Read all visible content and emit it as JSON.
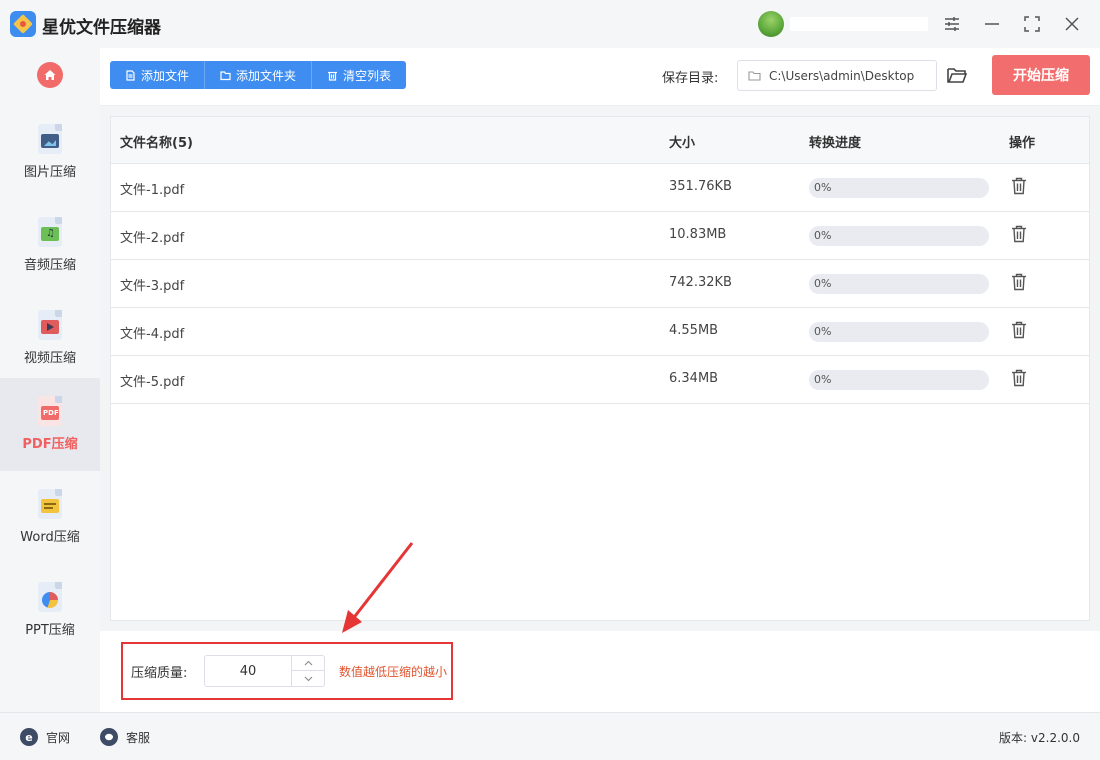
{
  "app": {
    "title": "星优文件压缩器"
  },
  "window_controls": [
    "settings-icon",
    "minimize-icon",
    "maximize-icon",
    "close-icon"
  ],
  "sidebar": {
    "items": [
      {
        "label": "图片压缩",
        "icon": "image-file-icon",
        "active": false
      },
      {
        "label": "音频压缩",
        "icon": "audio-file-icon",
        "active": false
      },
      {
        "label": "视频压缩",
        "icon": "video-file-icon",
        "active": false
      },
      {
        "label": "PDF压缩",
        "icon": "pdf-file-icon",
        "active": true
      },
      {
        "label": "Word压缩",
        "icon": "word-file-icon",
        "active": false
      },
      {
        "label": "PPT压缩",
        "icon": "ppt-file-icon",
        "active": false
      }
    ]
  },
  "toolbar": {
    "add_file": "添加文件",
    "add_folder": "添加文件夹",
    "clear_list": "清空列表",
    "save_dir_label": "保存目录:",
    "save_dir_path": "C:\\Users\\admin\\Desktop",
    "start_button": "开始压缩"
  },
  "table": {
    "headers": {
      "name": "文件名称(5)",
      "size": "大小",
      "progress": "转换进度",
      "action": "操作"
    },
    "rows": [
      {
        "name": "文件-1.pdf",
        "size": "351.76KB",
        "progress": 0,
        "progress_label": "0%"
      },
      {
        "name": "文件-2.pdf",
        "size": "10.83MB",
        "progress": 0,
        "progress_label": "0%"
      },
      {
        "name": "文件-3.pdf",
        "size": "742.32KB",
        "progress": 0,
        "progress_label": "0%"
      },
      {
        "name": "文件-4.pdf",
        "size": "4.55MB",
        "progress": 0,
        "progress_label": "0%"
      },
      {
        "name": "文件-5.pdf",
        "size": "6.34MB",
        "progress": 0,
        "progress_label": "0%"
      }
    ]
  },
  "settings": {
    "quality_label": "压缩质量:",
    "quality_value": "40",
    "hint": "数值越低压缩的越小"
  },
  "statusbar": {
    "website": "官网",
    "support": "客服",
    "version": "版本: v2.2.0.0"
  },
  "colors": {
    "accent": "#3f8df1",
    "start": "#f26e6e",
    "active_text": "#f06060",
    "highlight": "#e53535"
  }
}
